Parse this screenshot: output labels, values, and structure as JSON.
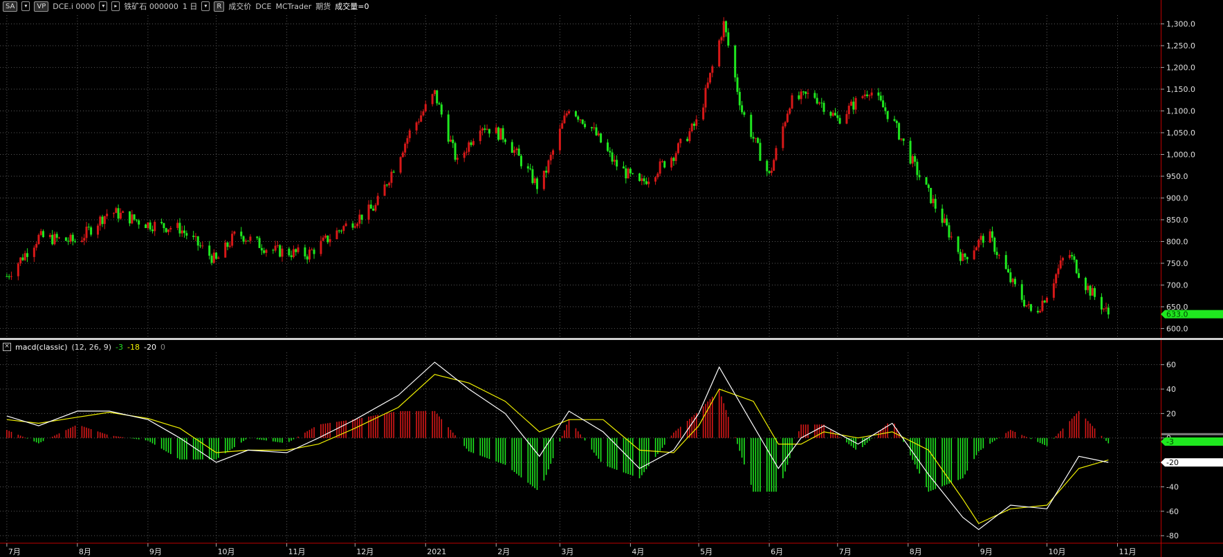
{
  "toolbar": {
    "symbol_button": "SA",
    "vp_button": "VP",
    "exchange_symbol": "DCE.i 0000",
    "instrument": "铁矿石 000000",
    "interval": "1 日",
    "r_button": "R",
    "quote_field": "成交价",
    "exchange": "DCE",
    "source": "MCTrader",
    "category": "期货",
    "volume_label": "成交量=0"
  },
  "macd": {
    "name": "macd(classic)",
    "params": "(12, 26, 9)",
    "v_macd": "-3",
    "v_signal": "-18",
    "v_diff": "-20",
    "v_zero": "0"
  },
  "colors": {
    "up": "#d81818",
    "down": "#1fe81f",
    "macd_line": "#ffffff",
    "signal_line": "#f0f000",
    "grid": "#5a5a5a",
    "separator": "#d0d0d0",
    "axis_border": "#c00000"
  },
  "chart_data": [
    {
      "type": "candlestick",
      "title": "",
      "y_ticks": [
        "1,300.0",
        "1,250.0",
        "1,200.0",
        "1,150.0",
        "1,100.0",
        "1,050.0",
        "1,000.0",
        "950.0",
        "900.0",
        "850.0",
        "800.0",
        "750.0",
        "700.0",
        "650.0",
        "600.0"
      ],
      "ylim": [
        580,
        1320
      ],
      "last_price": "633.0",
      "x_labels": [
        "7月",
        "8月",
        "9月",
        "10月",
        "11月",
        "12月",
        "2021",
        "2月",
        "3月",
        "4月",
        "5月",
        "6月",
        "7月",
        "8月",
        "9月",
        "10月",
        "11月"
      ],
      "grid": true,
      "close_series": [
        {
          "date": "2020-07-01",
          "close": 720
        },
        {
          "date": "2020-07-15",
          "close": 810
        },
        {
          "date": "2020-08-01",
          "close": 800
        },
        {
          "date": "2020-08-15",
          "close": 870
        },
        {
          "date": "2020-09-01",
          "close": 840
        },
        {
          "date": "2020-09-15",
          "close": 830
        },
        {
          "date": "2020-10-01",
          "close": 755
        },
        {
          "date": "2020-10-10",
          "close": 820
        },
        {
          "date": "2020-10-25",
          "close": 780
        },
        {
          "date": "2020-11-10",
          "close": 770
        },
        {
          "date": "2020-11-25",
          "close": 830
        },
        {
          "date": "2020-12-10",
          "close": 880
        },
        {
          "date": "2020-12-25",
          "close": 1050
        },
        {
          "date": "2021-01-05",
          "close": 1140
        },
        {
          "date": "2021-01-15",
          "close": 980
        },
        {
          "date": "2021-01-25",
          "close": 1070
        },
        {
          "date": "2021-02-05",
          "close": 1040
        },
        {
          "date": "2021-02-20",
          "close": 920
        },
        {
          "date": "2021-03-05",
          "close": 1110
        },
        {
          "date": "2021-03-15",
          "close": 1060
        },
        {
          "date": "2021-03-25",
          "close": 980
        },
        {
          "date": "2021-04-05",
          "close": 930
        },
        {
          "date": "2021-04-20",
          "close": 1000
        },
        {
          "date": "2021-05-01",
          "close": 1080
        },
        {
          "date": "2021-05-12",
          "close": 1300
        },
        {
          "date": "2021-05-20",
          "close": 1100
        },
        {
          "date": "2021-06-01",
          "close": 950
        },
        {
          "date": "2021-06-10",
          "close": 1120
        },
        {
          "date": "2021-06-20",
          "close": 1140
        },
        {
          "date": "2021-07-01",
          "close": 1080
        },
        {
          "date": "2021-07-15",
          "close": 1150
        },
        {
          "date": "2021-07-25",
          "close": 1080
        },
        {
          "date": "2021-08-05",
          "close": 960
        },
        {
          "date": "2021-08-15",
          "close": 860
        },
        {
          "date": "2021-08-25",
          "close": 760
        },
        {
          "date": "2021-09-05",
          "close": 820
        },
        {
          "date": "2021-09-15",
          "close": 710
        },
        {
          "date": "2021-09-25",
          "close": 630
        },
        {
          "date": "2021-10-01",
          "close": 680
        },
        {
          "date": "2021-10-10",
          "close": 780
        },
        {
          "date": "2021-10-18",
          "close": 700
        },
        {
          "date": "2021-10-28",
          "close": 633
        }
      ]
    },
    {
      "type": "line",
      "title": "",
      "y_ticks": [
        "60",
        "40",
        "20",
        "0",
        "-20",
        "-40",
        "-60",
        "-80"
      ],
      "ylim": [
        -85,
        70
      ],
      "series": [
        {
          "name": "",
          "values": [
            {
              "date": "2020-07-01",
              "value": 18
            },
            {
              "date": "2020-07-15",
              "value": 10
            },
            {
              "date": "2020-08-01",
              "value": 22
            },
            {
              "date": "2020-08-15",
              "value": 22
            },
            {
              "date": "2020-09-01",
              "value": 15
            },
            {
              "date": "2020-09-15",
              "value": 0
            },
            {
              "date": "2020-10-01",
              "value": -20
            },
            {
              "date": "2020-10-15",
              "value": -10
            },
            {
              "date": "2020-11-01",
              "value": -12
            },
            {
              "date": "2020-11-15",
              "value": 0
            },
            {
              "date": "2020-12-01",
              "value": 15
            },
            {
              "date": "2020-12-20",
              "value": 35
            },
            {
              "date": "2021-01-05",
              "value": 62
            },
            {
              "date": "2021-01-20",
              "value": 40
            },
            {
              "date": "2021-02-05",
              "value": 20
            },
            {
              "date": "2021-02-20",
              "value": -15
            },
            {
              "date": "2021-03-05",
              "value": 22
            },
            {
              "date": "2021-03-20",
              "value": 5
            },
            {
              "date": "2021-04-05",
              "value": -25
            },
            {
              "date": "2021-04-20",
              "value": -10
            },
            {
              "date": "2021-05-01",
              "value": 20
            },
            {
              "date": "2021-05-10",
              "value": 58
            },
            {
              "date": "2021-05-25",
              "value": 10
            },
            {
              "date": "2021-06-05",
              "value": -25
            },
            {
              "date": "2021-06-15",
              "value": 0
            },
            {
              "date": "2021-06-25",
              "value": 10
            },
            {
              "date": "2021-07-10",
              "value": -5
            },
            {
              "date": "2021-07-25",
              "value": 12
            },
            {
              "date": "2021-08-10",
              "value": -30
            },
            {
              "date": "2021-08-25",
              "value": -65
            },
            {
              "date": "2021-09-01",
              "value": -75
            },
            {
              "date": "2021-09-15",
              "value": -55
            },
            {
              "date": "2021-10-01",
              "value": -58
            },
            {
              "date": "2021-10-15",
              "value": -15
            },
            {
              "date": "2021-10-28",
              "value": -20
            }
          ]
        },
        {
          "name": "",
          "values": [
            {
              "date": "2020-07-01",
              "value": 15
            },
            {
              "date": "2020-07-15",
              "value": 12
            },
            {
              "date": "2020-08-01",
              "value": 17
            },
            {
              "date": "2020-08-15",
              "value": 21
            },
            {
              "date": "2020-09-01",
              "value": 16
            },
            {
              "date": "2020-09-15",
              "value": 8
            },
            {
              "date": "2020-10-01",
              "value": -12
            },
            {
              "date": "2020-10-15",
              "value": -10
            },
            {
              "date": "2020-11-01",
              "value": -10
            },
            {
              "date": "2020-11-15",
              "value": -5
            },
            {
              "date": "2020-12-01",
              "value": 8
            },
            {
              "date": "2020-12-20",
              "value": 25
            },
            {
              "date": "2021-01-05",
              "value": 52
            },
            {
              "date": "2021-01-20",
              "value": 45
            },
            {
              "date": "2021-02-05",
              "value": 30
            },
            {
              "date": "2021-02-20",
              "value": 5
            },
            {
              "date": "2021-03-05",
              "value": 15
            },
            {
              "date": "2021-03-20",
              "value": 15
            },
            {
              "date": "2021-04-05",
              "value": -10
            },
            {
              "date": "2021-04-20",
              "value": -12
            },
            {
              "date": "2021-05-01",
              "value": 10
            },
            {
              "date": "2021-05-10",
              "value": 40
            },
            {
              "date": "2021-05-25",
              "value": 30
            },
            {
              "date": "2021-06-05",
              "value": -5
            },
            {
              "date": "2021-06-15",
              "value": -5
            },
            {
              "date": "2021-06-25",
              "value": 5
            },
            {
              "date": "2021-07-10",
              "value": 0
            },
            {
              "date": "2021-07-25",
              "value": 5
            },
            {
              "date": "2021-08-10",
              "value": -10
            },
            {
              "date": "2021-08-25",
              "value": -50
            },
            {
              "date": "2021-09-01",
              "value": -70
            },
            {
              "date": "2021-09-15",
              "value": -58
            },
            {
              "date": "2021-10-01",
              "value": -55
            },
            {
              "date": "2021-10-15",
              "value": -25
            },
            {
              "date": "2021-10-28",
              "value": -18
            }
          ]
        }
      ],
      "histogram_note": "red above zero, green below zero",
      "last_values": [
        "-3",
        "-20"
      ]
    }
  ]
}
